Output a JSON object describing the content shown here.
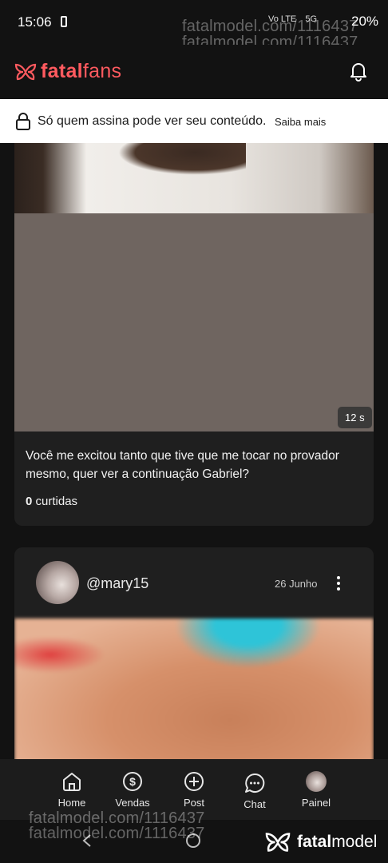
{
  "status": {
    "time": "15:06",
    "icons": [
      "Vo LTE",
      "5G"
    ],
    "battery": "20%"
  },
  "watermarks": {
    "top_line1": "fatalmodel.com/1116437",
    "top_line2": "fatalmodel.com/1116437",
    "bottom_line1": "fatalmodel.com/1116437",
    "bottom_line2": "fatalmodel.com/1116437",
    "brand_bold": "fatal",
    "brand_regular": "model"
  },
  "header": {
    "brand_bold": "fatal",
    "brand_regular": "fans",
    "brand_color": "#ff5a5f"
  },
  "lock_banner": {
    "text": "Só quem assina pode ver seu conteúdo.",
    "link": "Saiba mais"
  },
  "post1": {
    "duration": "12 s",
    "caption": "Você me excitou tanto que tive que me tocar no provador mesmo, quer ver a continuação Gabriel?",
    "likes_count": "0",
    "likes_label": "curtidas"
  },
  "post2": {
    "username": "@mary15",
    "date": "26 Junho"
  },
  "bottom_nav": {
    "items": [
      {
        "label": "Home",
        "icon": "home-icon"
      },
      {
        "label": "Vendas",
        "icon": "dollar-icon"
      },
      {
        "label": "Post",
        "icon": "plus-circle-icon"
      },
      {
        "label": "Chat",
        "icon": "chat-icon"
      },
      {
        "label": "Painel",
        "icon": "avatar"
      }
    ]
  }
}
